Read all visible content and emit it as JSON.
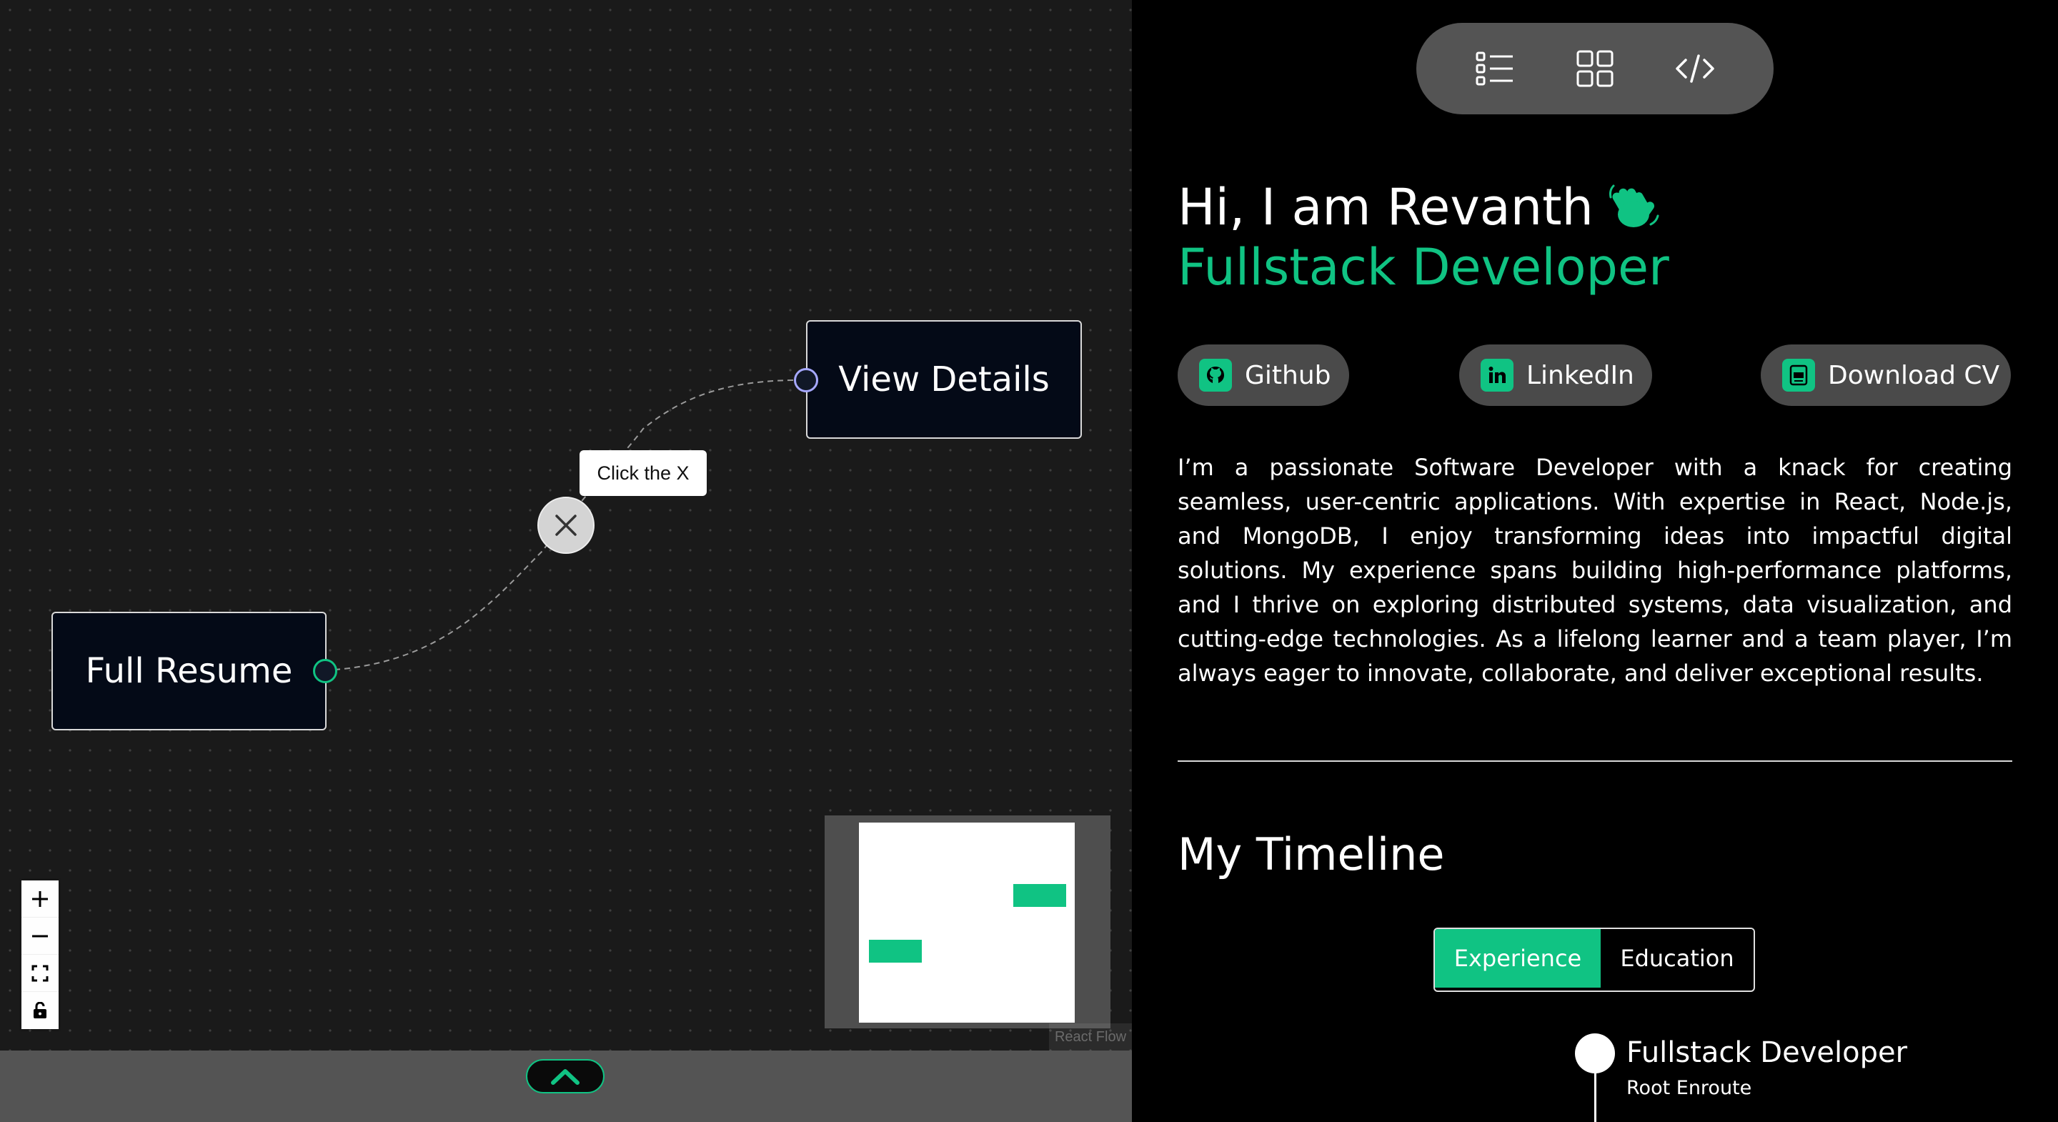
{
  "flow": {
    "nodes": {
      "full_resume": "Full Resume",
      "view_details": "View Details"
    },
    "edge_tooltip": "Click the X",
    "attribution": "React Flow",
    "colors": {
      "accent": "#10c383",
      "target_handle": "#a6a8ff",
      "canvas": "#1a1a1a"
    },
    "controls": [
      {
        "name": "zoom-in-icon"
      },
      {
        "name": "zoom-out-icon"
      },
      {
        "name": "fit-view-icon"
      },
      {
        "name": "lock-icon"
      }
    ]
  },
  "drawer": {
    "toggle_icon": "chevron-up-icon"
  },
  "view_switch": [
    {
      "name": "list-view-icon"
    },
    {
      "name": "grid-view-icon"
    },
    {
      "name": "code-view-icon"
    }
  ],
  "hero": {
    "greeting": "Hi, I am Revanth",
    "wave_icon": "waving-hand-icon",
    "role": "Fullstack Developer"
  },
  "links": {
    "github": "Github",
    "linkedin": "LinkedIn",
    "download_cv": "Download CV"
  },
  "about": "I’m a passionate Software Developer with a knack for creating seamless, user-centric applications. With expertise in React, Node.js, and MongoDB, I enjoy transforming ideas into impactful digital solutions. My experience spans building high-performance platforms, and I thrive on exploring distributed systems, data visualization, and cutting-edge technologies. As a lifelong learner and a team player, I’m always eager to innovate, collaborate, and deliver exceptional results.",
  "timeline": {
    "title": "My Timeline",
    "tabs": {
      "experience": "Experience",
      "education": "Education",
      "active": "Experience"
    },
    "entries": [
      {
        "title": "Fullstack Developer",
        "company": "Root Enroute"
      }
    ]
  }
}
